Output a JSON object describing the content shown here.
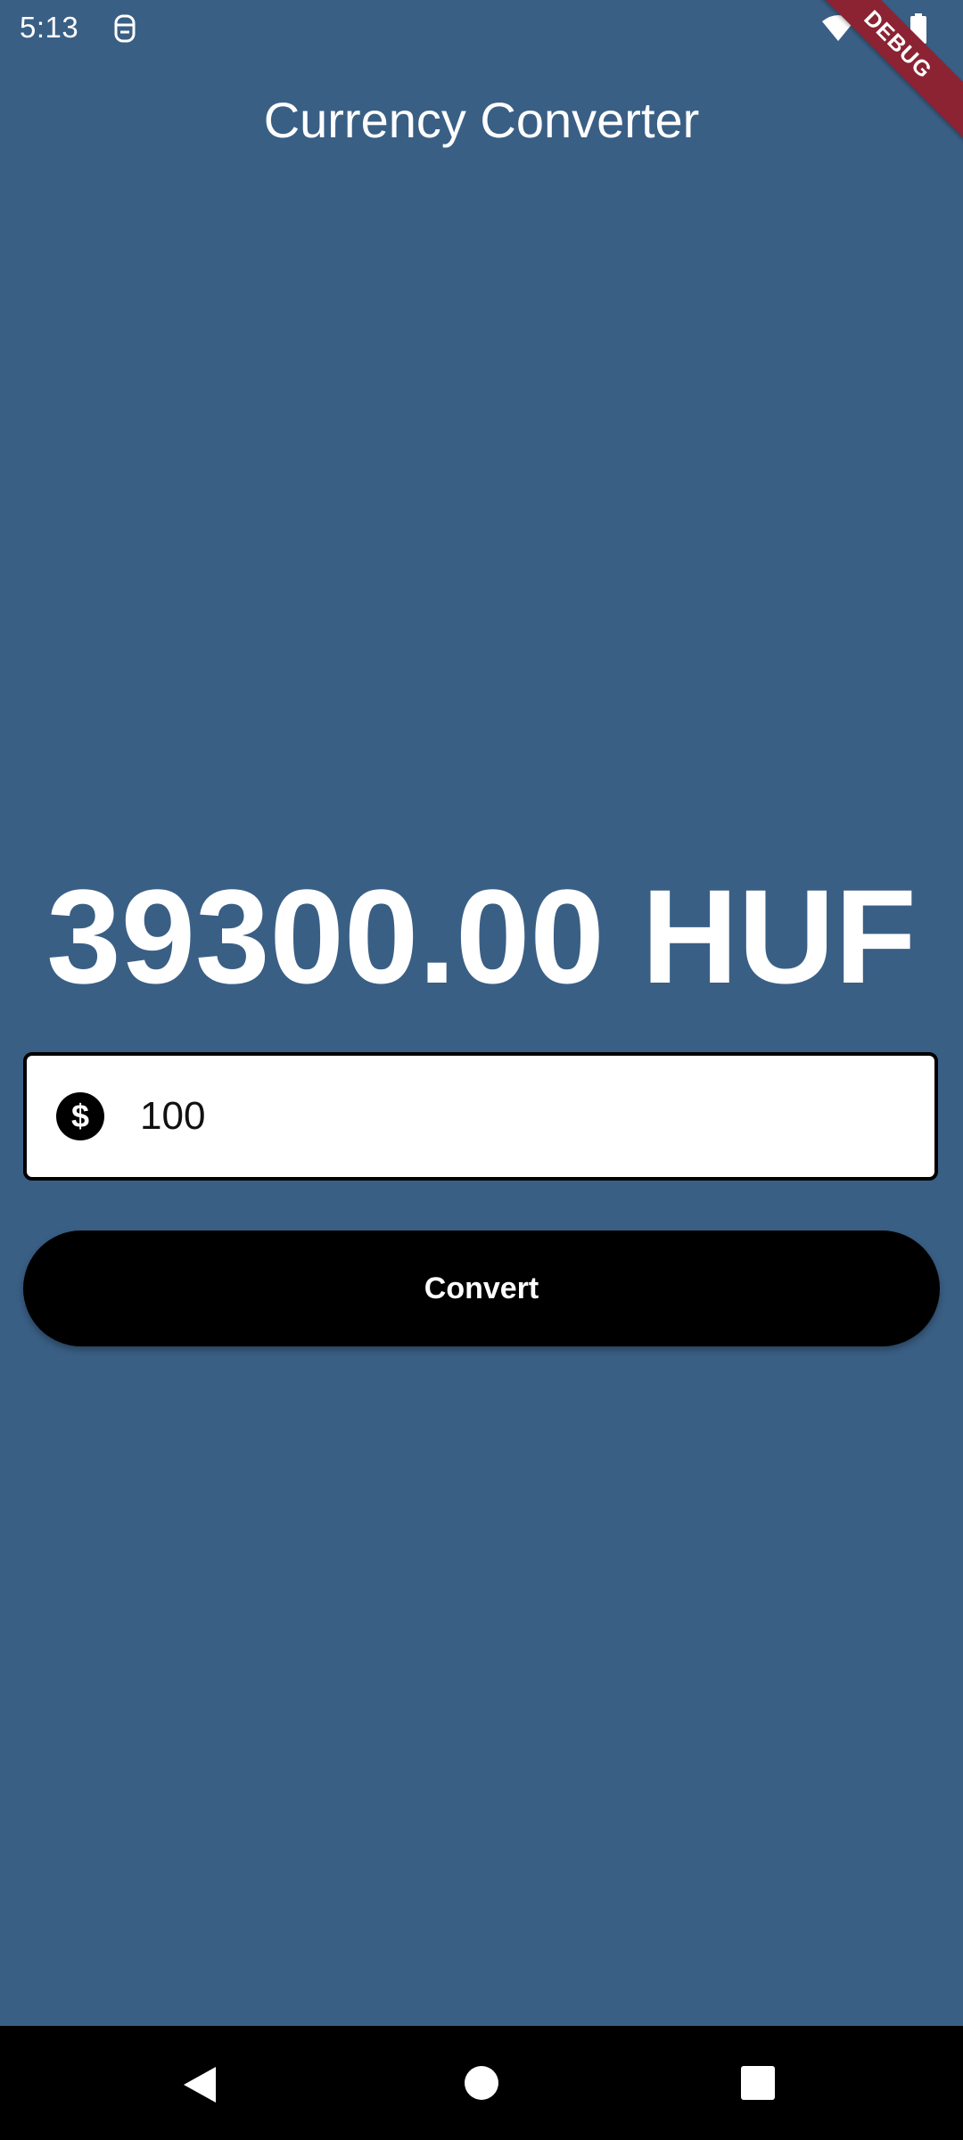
{
  "status_bar": {
    "time": "5:13",
    "icons": [
      "app-notification-icon",
      "wifi-icon",
      "signal-icon",
      "battery-icon"
    ]
  },
  "debug_banner": {
    "label": "DEBUG",
    "color": "#8b2332"
  },
  "app_bar": {
    "title": "Currency Converter"
  },
  "result": {
    "text": "39300.00 HUF"
  },
  "amount_field": {
    "value": "100",
    "icon": "dollar-icon"
  },
  "convert_button": {
    "label": "Convert"
  },
  "nav_bar": {
    "icons": [
      "back-icon",
      "home-icon",
      "recents-icon"
    ]
  },
  "colors": {
    "background": "#3a5f85",
    "button": "#000000",
    "text": "#ffffff"
  }
}
